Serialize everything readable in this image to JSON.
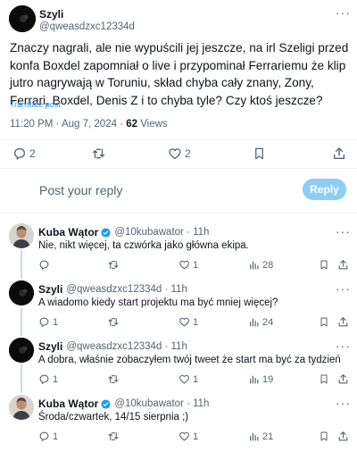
{
  "main_post": {
    "name": "Szyli",
    "handle": "@qweasdzxc12334d",
    "text": "Znaczy nagrali, ale nie wypuścili jej jeszcze, na irl Szeligi przed konfa Boxdel zapomniał o live i przypominał Ferrariemu że klip jutro nagrywają w Toruniu, skład chyba cały znany, Zony, Ferrari, Boxdel, Denis Z i to chyba tyle? Czy ktoś jeszcze?",
    "translate": "Translate post",
    "time": "11:20 PM · Aug 7, 2024 · ",
    "views_count": "62",
    "views_label": " Views",
    "stats": {
      "replies": "2",
      "reposts": "",
      "likes": "2"
    }
  },
  "reply_box": {
    "placeholder": "Post your reply",
    "button": "Reply"
  },
  "replies": [
    {
      "name": "Kuba Wątor",
      "handle": "@10kubawator · 11h",
      "text": "Nie, nikt więcej, ta czwórka jako główna ekipa.",
      "replies": "",
      "reposts": "",
      "likes": "1",
      "views": "28"
    },
    {
      "name": "Szyli",
      "handle": "@qweasdzxc12334d · 11h",
      "text": "A wiadomo kiedy start projektu ma być mniej więcej?",
      "replies": "1",
      "reposts": "",
      "likes": "1",
      "views": "24"
    },
    {
      "name": "Szyli",
      "handle": "@qweasdzxc12334d · 11h",
      "text": "A dobra, właśnie zobaczyłem twój tweet że start ma być za tydzień",
      "replies": "1",
      "reposts": "",
      "likes": "1",
      "views": "19"
    },
    {
      "name": "Kuba Wątor",
      "handle": "@10kubawator · 11h",
      "text": "Środa/czwartek, 14/15 sierpnia ;)",
      "replies": "1",
      "reposts": "",
      "likes": "1",
      "views": "21"
    }
  ],
  "colors": {
    "accent": "#1d9bf0",
    "muted": "#536471",
    "verified": "#1d9bf0"
  },
  "icons": [
    "reply-icon",
    "repost-icon",
    "like-icon",
    "bookmark-icon",
    "share-icon",
    "views-icon",
    "more-icon",
    "verified-icon"
  ]
}
